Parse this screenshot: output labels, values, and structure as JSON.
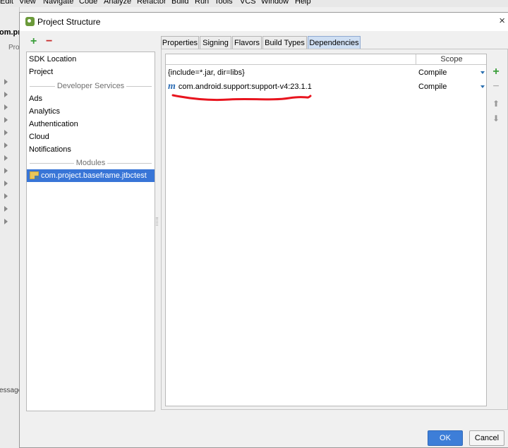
{
  "ide": {
    "menu": [
      "Edit",
      "View",
      "Navigate",
      "Code",
      "Analyze",
      "Refactor",
      "Build",
      "Run",
      "Tools",
      "VCS",
      "Window",
      "Help"
    ],
    "fragments": {
      "project_name": "om.pr",
      "proj_tab": "Pro",
      "messages": "essage"
    }
  },
  "dialog": {
    "title": "Project Structure",
    "close": "×"
  },
  "left_toolbar": {
    "add": "+",
    "remove": "−"
  },
  "left_list": {
    "items_top": [
      "SDK Location",
      "Project"
    ],
    "developer_services_header": "Developer Services",
    "services": [
      "Ads",
      "Analytics",
      "Authentication",
      "Cloud",
      "Notifications"
    ],
    "modules_header": "Modules",
    "module": "com.project.baseframe.jtbctest"
  },
  "tabs": [
    "Properties",
    "Signing",
    "Flavors",
    "Build Types",
    "Dependencies"
  ],
  "active_tab": "Dependencies",
  "table": {
    "scope_header": "Scope",
    "rows": [
      {
        "dependency": "{include=*.jar, dir=libs}",
        "scope": "Compile",
        "icon": ""
      },
      {
        "dependency": "com.android.support:support-v4:23.1.1",
        "scope": "Compile",
        "icon": "m"
      }
    ]
  },
  "right_toolbar": {
    "add": "+",
    "remove": "−",
    "up": "⬆",
    "down": "⬇"
  },
  "buttons": {
    "ok": "OK",
    "cancel": "Cancel"
  },
  "colors": {
    "selection": "#3875d7",
    "active_tab": "#cfdff3",
    "ok_button": "#3d7ed8",
    "annotation_red": "#e8141e",
    "add_green": "#3a9e3a",
    "remove_red": "#c72a2a"
  }
}
